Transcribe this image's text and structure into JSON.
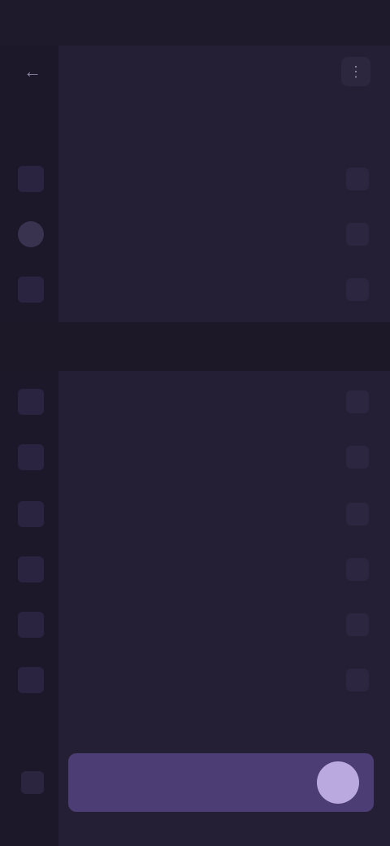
{
  "status_bar": {
    "time": "",
    "icons": ""
  },
  "topbar": {
    "back_icon": "arrow-left-icon",
    "title": "",
    "action_icon": "more-icon"
  },
  "sections": [
    {
      "label": "",
      "rows": [
        {
          "label": "",
          "icon": "square-icon",
          "trail": ""
        },
        {
          "label": "",
          "icon": "circle-icon",
          "trail": ""
        },
        {
          "label": "",
          "icon": "square-icon",
          "trail": ""
        }
      ]
    },
    {
      "label": "",
      "rows": [
        {
          "label": "",
          "icon": "square-icon",
          "trail": ""
        },
        {
          "label": "",
          "icon": "square-icon",
          "trail": ""
        },
        {
          "label": "",
          "icon": "square-icon",
          "trail": ""
        },
        {
          "label": "",
          "icon": "square-icon",
          "trail": ""
        },
        {
          "label": "",
          "icon": "square-icon",
          "trail": ""
        },
        {
          "label": "",
          "icon": "square-icon",
          "trail": ""
        }
      ]
    }
  ],
  "primary": {
    "label": "",
    "fab_icon": "circle-icon"
  },
  "colors": {
    "background": "#241f35",
    "rail": "#1d1829",
    "accent": "#4c3d74",
    "accent_light": "#b9a9df"
  }
}
